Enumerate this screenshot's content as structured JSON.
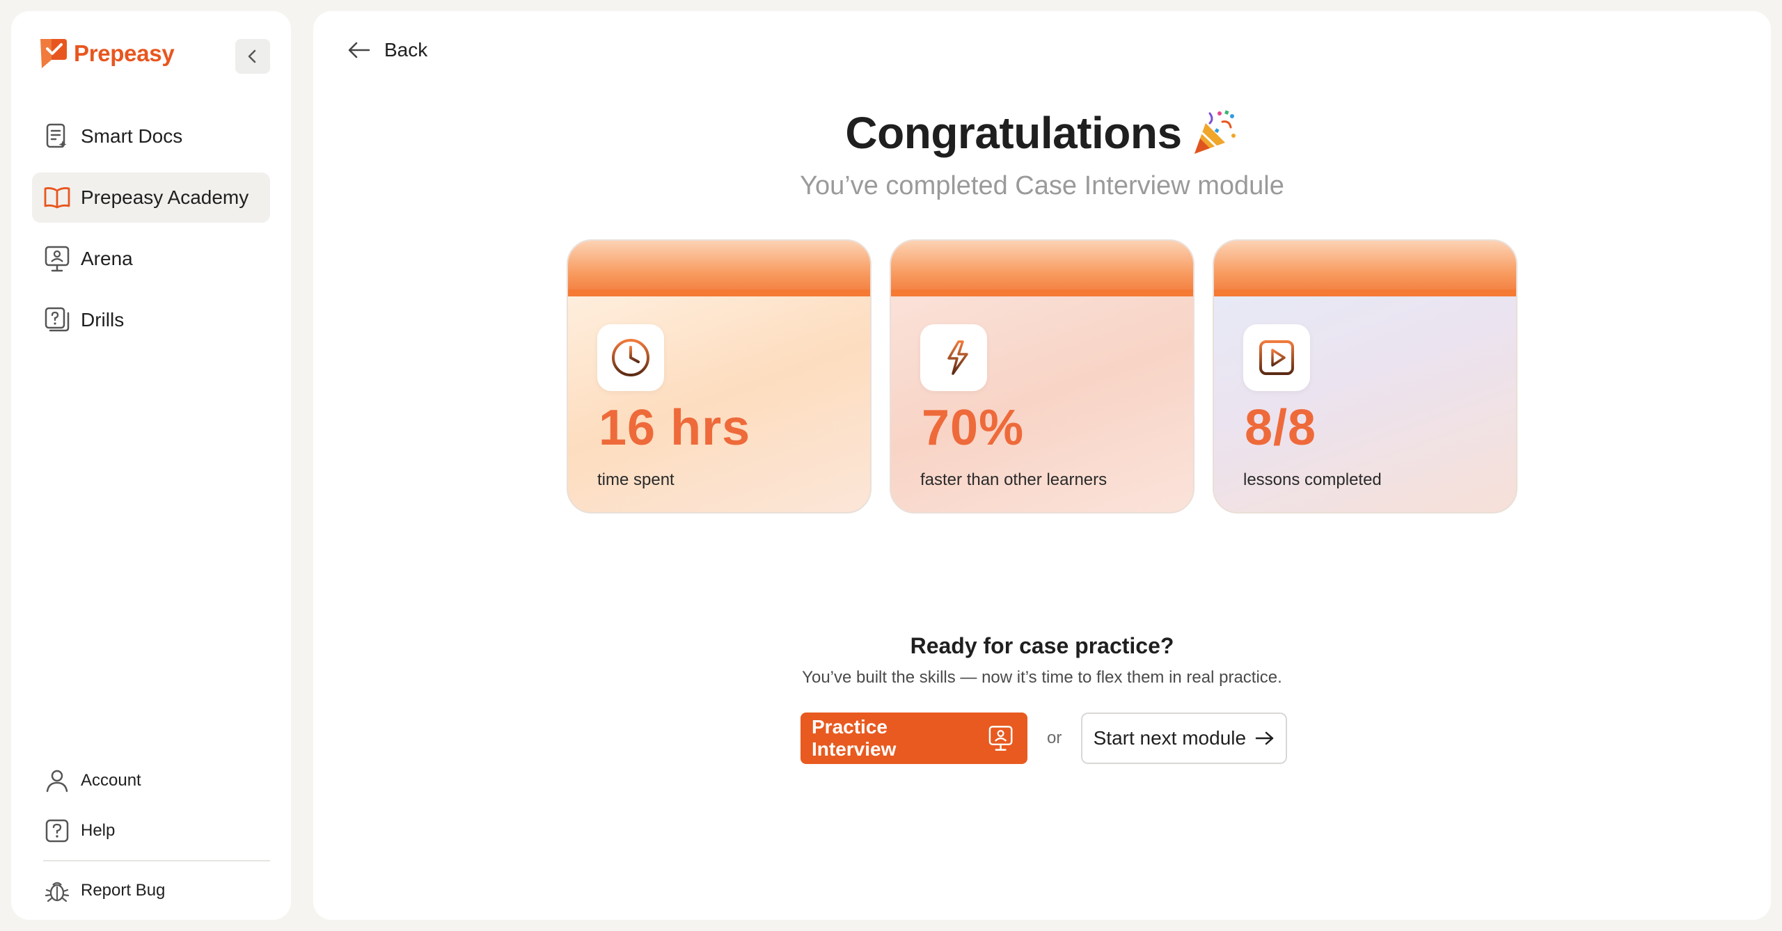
{
  "app": {
    "brand_name": "Prepeasy",
    "accent_color": "#e8561f"
  },
  "sidebar": {
    "collapse_icon": "chevron-left-icon",
    "items": [
      {
        "label": "Smart Docs",
        "icon": "document-sparkle-icon",
        "active": false
      },
      {
        "label": "Prepeasy Academy",
        "icon": "open-book-icon",
        "active": true
      },
      {
        "label": "Arena",
        "icon": "presentation-icon",
        "active": false
      },
      {
        "label": "Drills",
        "icon": "question-cards-icon",
        "active": false
      }
    ],
    "bottom_items": [
      {
        "label": "Account",
        "icon": "user-icon"
      },
      {
        "label": "Help",
        "icon": "question-icon"
      },
      {
        "label": "Report Bug",
        "icon": "bug-icon"
      }
    ]
  },
  "main": {
    "back_label": "Back",
    "title": "Congratulations",
    "title_emoji": "🎉",
    "subtitle": "You’ve completed Case Interview module",
    "stats": [
      {
        "value": "16 hrs",
        "caption": "time spent",
        "icon": "clock-icon"
      },
      {
        "value": "70%",
        "caption": "faster than other learners",
        "icon": "lightning-speed-icon"
      },
      {
        "value": "8/8",
        "caption": "lessons completed",
        "icon": "play-icon"
      }
    ],
    "cta": {
      "title": "Ready for case practice?",
      "subtitle": "You’ve built the skills — now it’s time to flex them in real practice.",
      "primary_label": "Practice Interview",
      "or_label": "or",
      "secondary_label": "Start next module"
    }
  }
}
